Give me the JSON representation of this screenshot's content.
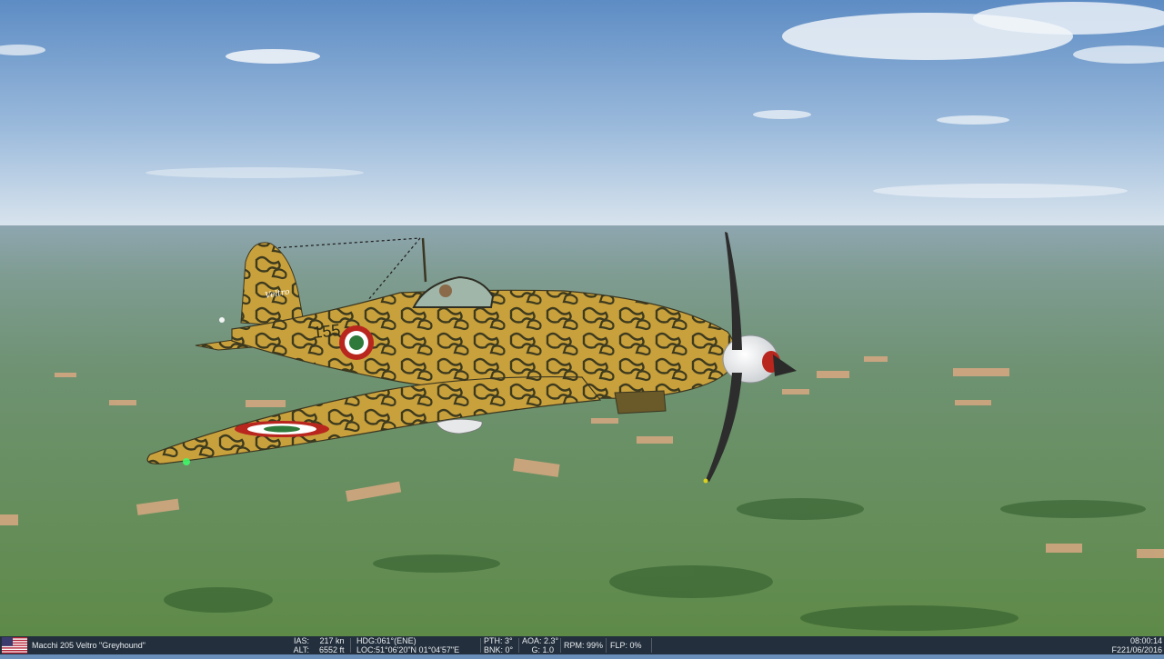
{
  "aircraft": {
    "name": "Macchi 205 Veltro \"Greyhound\"",
    "country_flag": "us-flag-icon",
    "tail_number": "155",
    "tail_text": "Veltro"
  },
  "hud": {
    "ias_label": "IAS:",
    "ias_value": "217 kn",
    "alt_label": "ALT:",
    "alt_value": "6552 ft",
    "hdg_label": "HDG:",
    "hdg_value": "061°(ENE)",
    "loc_label": "LOC:",
    "loc_value": "51°06'20\"N 01°04'57\"E",
    "pth_label": "PTH:",
    "pth_value": "3°",
    "bnk_label": "BNK:",
    "bnk_value": "0°",
    "aoa_label": "AOA:",
    "aoa_value": "2.3°",
    "g_label": "G:",
    "g_value": "1.0",
    "rpm_label": "RPM:",
    "rpm_value": "99%",
    "flp_label": "FLP:",
    "flp_value": "0%",
    "time": "08:00:14",
    "date": "F221/06/2016"
  },
  "colors": {
    "sky_top": "#5d8cc4",
    "sky_horizon": "#d8e4ee",
    "ground": "#5e8a4a",
    "camo_base": "#c8a03a",
    "camo_spots": "#3a3a20",
    "roundel_red": "#b8261e",
    "roundel_green": "#2f7a3a"
  }
}
